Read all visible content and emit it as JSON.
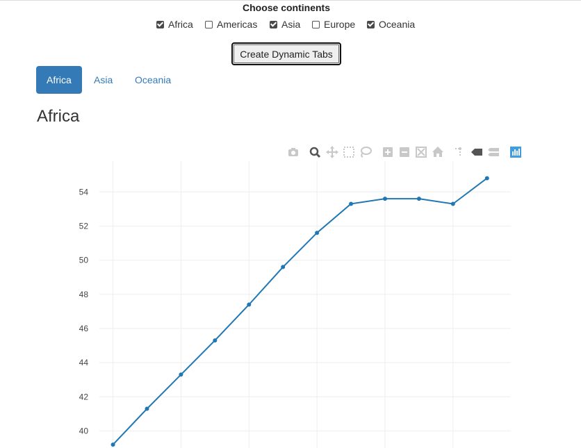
{
  "form": {
    "title": "Choose continents",
    "continents": [
      {
        "label": "Africa",
        "checked": true
      },
      {
        "label": "Americas",
        "checked": false
      },
      {
        "label": "Asia",
        "checked": true
      },
      {
        "label": "Europe",
        "checked": false
      },
      {
        "label": "Oceania",
        "checked": true
      }
    ],
    "button_label": "Create Dynamic Tabs"
  },
  "tabs": [
    {
      "label": "Africa",
      "active": true
    },
    {
      "label": "Asia",
      "active": false
    },
    {
      "label": "Oceania",
      "active": false
    }
  ],
  "page_title": "Africa",
  "modebar": [
    "camera-icon",
    "zoom-icon",
    "pan-icon",
    "box-select-icon",
    "lasso-select-icon",
    "zoom-in-icon",
    "zoom-out-icon",
    "autoscale-icon",
    "reset-axes-icon",
    "spike-lines-icon",
    "hover-closest-icon",
    "hover-compare-icon",
    "plotly-logo-icon"
  ],
  "colors": {
    "accent": "#337ab7",
    "line": "#1f77b4",
    "grid": "#eeeeee",
    "modebar_icon": "#c8c8c8",
    "modebar_active": "#555555",
    "plotly_logo": "#3f9ee0"
  },
  "chart_data": {
    "type": "line",
    "title": "",
    "xlabel": "",
    "ylabel": "",
    "y_ticks": [
      "40",
      "42",
      "44",
      "46",
      "48",
      "50",
      "52",
      "54"
    ],
    "ylim": [
      39,
      55.8
    ],
    "xlim": [
      -0.4,
      11.7
    ],
    "x": [
      0,
      1,
      2,
      3,
      4,
      5,
      6,
      7,
      8,
      9,
      10,
      11
    ],
    "values": [
      39.2,
      41.3,
      43.3,
      45.3,
      47.4,
      49.6,
      51.6,
      53.3,
      53.6,
      53.6,
      53.3,
      54.8
    ],
    "grid": true,
    "markers": true,
    "legend": "none"
  }
}
